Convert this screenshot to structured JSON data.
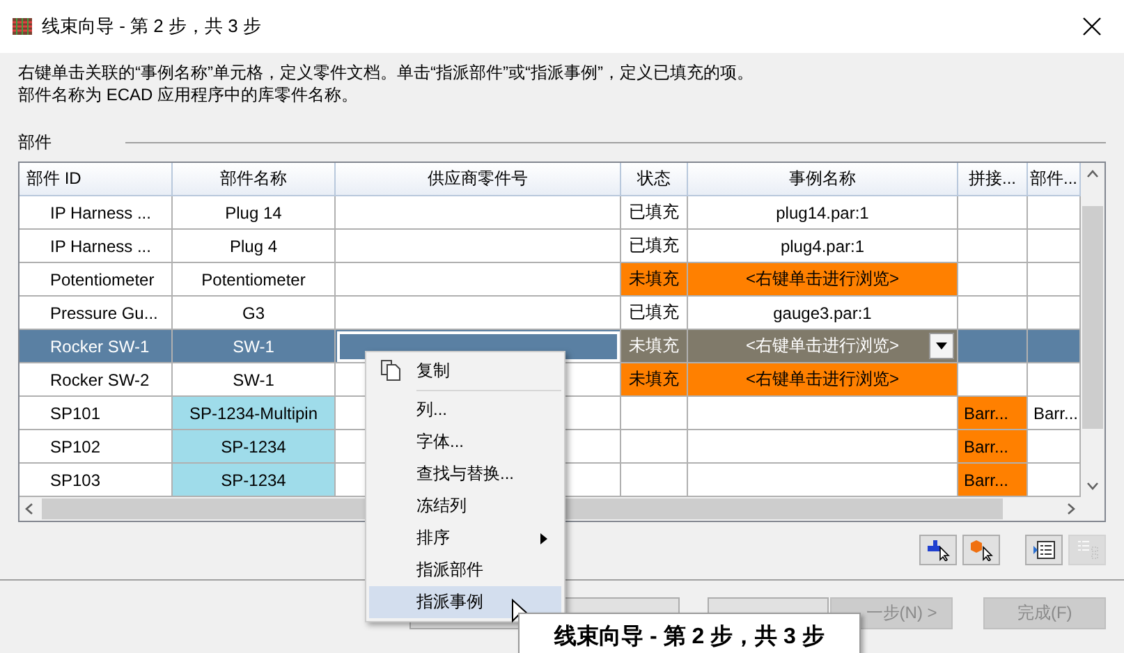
{
  "window": {
    "title": "线束向导 - 第 2 步，共 3 步"
  },
  "instructions": [
    "右键单击关联的“事例名称”单元格，定义零件文档。单击“指派部件”或“指派事例”，定义已填充的项。",
    "部件名称为 ECAD 应用程序中的库零件名称。"
  ],
  "group_label": "部件",
  "table": {
    "columns": [
      "部件 ID",
      "部件名称",
      "供应商零件号",
      "状态",
      "事例名称",
      "拼接...",
      "部件..."
    ],
    "rows": [
      {
        "id": "IP Harness ...",
        "name": "Plug 14",
        "name_highlighted": false,
        "status": "已填充",
        "filled": true,
        "instance": "plug14.par:1",
        "splice": "",
        "splice_highlighted": false,
        "part": "",
        "selected": false
      },
      {
        "id": "IP Harness ...",
        "name": "Plug 4",
        "name_highlighted": false,
        "status": "已填充",
        "filled": true,
        "instance": "plug4.par:1",
        "splice": "",
        "splice_highlighted": false,
        "part": "",
        "selected": false
      },
      {
        "id": "Potentiometer",
        "name": "Potentiometer",
        "name_highlighted": false,
        "status": "未填充",
        "filled": false,
        "instance": "<右键单击进行浏览>",
        "splice": "",
        "splice_highlighted": false,
        "part": "",
        "selected": false
      },
      {
        "id": "Pressure Gu...",
        "name": "G3",
        "name_highlighted": false,
        "status": "已填充",
        "filled": true,
        "instance": "gauge3.par:1",
        "splice": "",
        "splice_highlighted": false,
        "part": "",
        "selected": false
      },
      {
        "id": "Rocker SW-1",
        "name": "SW-1",
        "name_highlighted": false,
        "status": "未填充",
        "filled": false,
        "instance": "<右键单击进行浏览>",
        "splice": "",
        "splice_highlighted": false,
        "part": "",
        "selected": true
      },
      {
        "id": "Rocker SW-2",
        "name": "SW-1",
        "name_highlighted": false,
        "status": "未填充",
        "filled": false,
        "instance": "<右键单击进行浏览>",
        "splice": "",
        "splice_highlighted": false,
        "part": "",
        "selected": false
      },
      {
        "id": "SP101",
        "name": "SP-1234-Multipin",
        "name_highlighted": true,
        "status": "",
        "filled": true,
        "instance": "",
        "splice": "Barr...",
        "splice_highlighted": true,
        "part": "Barr...",
        "selected": false
      },
      {
        "id": "SP102",
        "name": "SP-1234",
        "name_highlighted": true,
        "status": "",
        "filled": true,
        "instance": "",
        "splice": "Barr...",
        "splice_highlighted": true,
        "part": "",
        "selected": false
      },
      {
        "id": "SP103",
        "name": "SP-1234",
        "name_highlighted": true,
        "status": "",
        "filled": true,
        "instance": "",
        "splice": "Barr...",
        "splice_highlighted": true,
        "part": "",
        "selected": false
      }
    ]
  },
  "toolbar": [
    {
      "kind": "assign-part",
      "disabled": false
    },
    {
      "kind": "assign-instance",
      "disabled": false
    },
    {
      "kind": "list",
      "disabled": false
    },
    {
      "kind": "tree",
      "disabled": true
    }
  ],
  "buttons": [
    {
      "disabled": false
    },
    {
      "disabled": false
    },
    {
      "disabled": false
    },
    {
      "label": "一步(N) >",
      "disabled": true
    },
    {
      "label": "完成(F)",
      "disabled": true
    }
  ],
  "context_menu": [
    {
      "label": "复制",
      "kind": "copy",
      "submenu": false,
      "selected": false
    },
    {
      "label": "列...",
      "kind": "item",
      "submenu": false,
      "selected": false
    },
    {
      "label": "字体...",
      "kind": "item",
      "submenu": false,
      "selected": false
    },
    {
      "label": "查找与替换...",
      "kind": "item",
      "submenu": false,
      "selected": false
    },
    {
      "label": "冻结列",
      "kind": "item",
      "submenu": false,
      "selected": false
    },
    {
      "label": "排序",
      "kind": "item",
      "submenu": true,
      "selected": false
    },
    {
      "label": "指派部件",
      "kind": "item",
      "submenu": false,
      "selected": false
    },
    {
      "label": "指派事例",
      "kind": "item",
      "submenu": false,
      "selected": true
    }
  ],
  "tooltip": "线束向导 - 第 2 步，共 3 步"
}
